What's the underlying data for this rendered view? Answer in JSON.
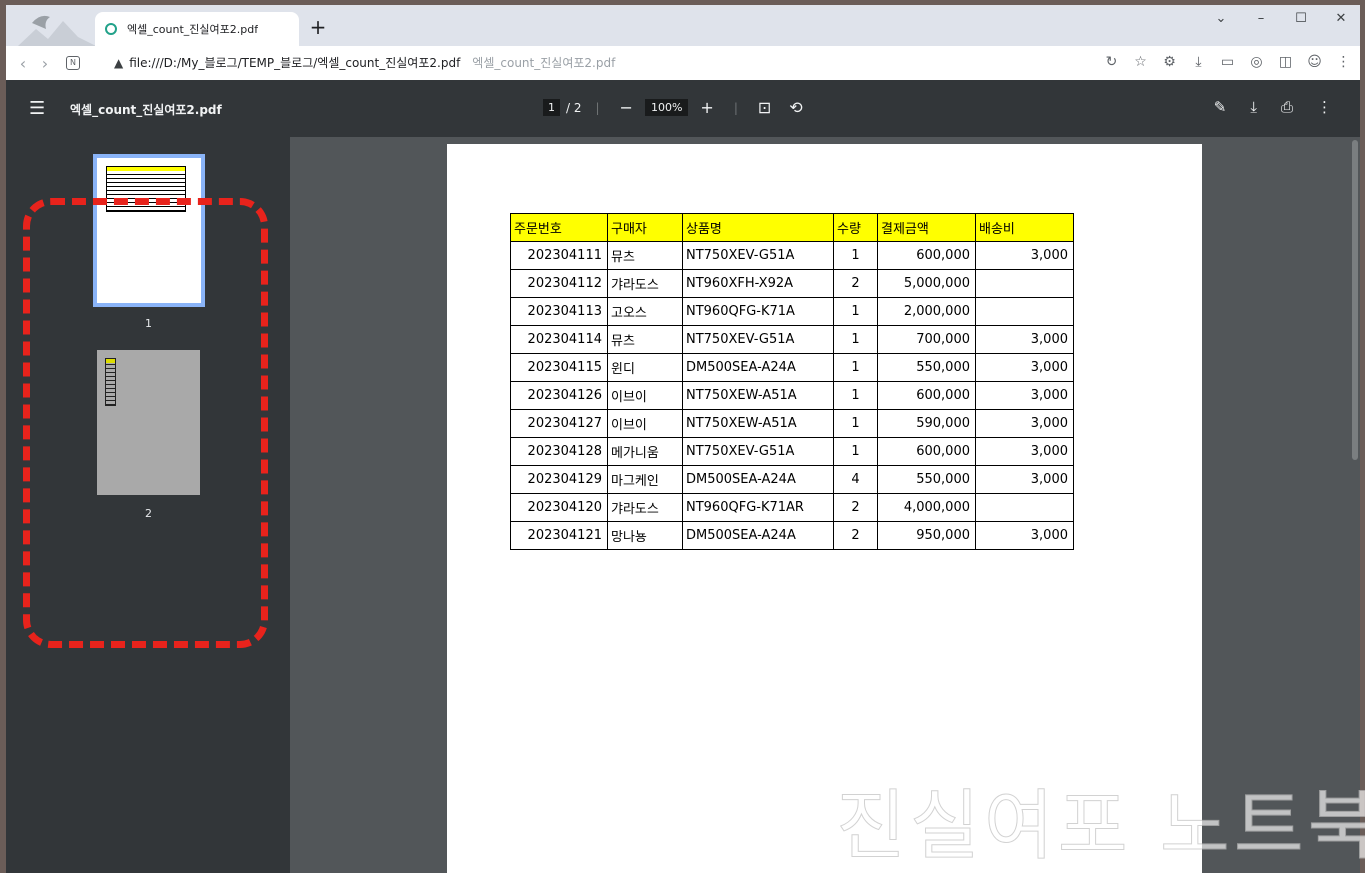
{
  "tab": {
    "title": "엑셀_count_진실여포2.pdf"
  },
  "address_bar": {
    "url": "file:///D:/My_블로그/TEMP_블로그/엑셀_count_진실여포2.pdf",
    "ghost_text": "엑셀_count_진실여포2.pdf"
  },
  "pdf_toolbar": {
    "doc_name": "엑셀_count_진실여포2.pdf",
    "current_page": "1",
    "total_pages": "/ 2",
    "zoom": "100%"
  },
  "thumbnails": [
    {
      "label": "1"
    },
    {
      "label": "2"
    }
  ],
  "table": {
    "headers": [
      "주문번호",
      "구매자",
      "상품명",
      "수량",
      "결제금액",
      "배송비"
    ],
    "rows": [
      [
        "202304111",
        "뮤츠",
        "NT750XEV-G51A",
        "1",
        "600,000",
        "3,000"
      ],
      [
        "202304112",
        "갸라도스",
        "NT960XFH-X92A",
        "2",
        "5,000,000",
        ""
      ],
      [
        "202304113",
        "고오스",
        "NT960QFG-K71A",
        "1",
        "2,000,000",
        ""
      ],
      [
        "202304114",
        "뮤츠",
        "NT750XEV-G51A",
        "1",
        "700,000",
        "3,000"
      ],
      [
        "202304115",
        "윈디",
        "DM500SEA-A24A",
        "1",
        "550,000",
        "3,000"
      ],
      [
        "202304126",
        "이브이",
        "NT750XEW-A51A",
        "1",
        "600,000",
        "3,000"
      ],
      [
        "202304127",
        "이브이",
        "NT750XEW-A51A",
        "1",
        "590,000",
        "3,000"
      ],
      [
        "202304128",
        "메가니움",
        "NT750XEV-G51A",
        "1",
        "600,000",
        "3,000"
      ],
      [
        "202304129",
        "마그케인",
        "DM500SEA-A24A",
        "4",
        "550,000",
        "3,000"
      ],
      [
        "202304120",
        "갸라도스",
        "NT960QFG-K71AR",
        "2",
        "4,000,000",
        ""
      ],
      [
        "202304121",
        "망나뇽",
        "DM500SEA-A24A",
        "2",
        "950,000",
        "3,000"
      ]
    ]
  },
  "watermark": "진실여포 노트북",
  "colors": {
    "accent": "#8ab4f8",
    "highlight": "#e8231c",
    "table_header": "#ffff00"
  }
}
